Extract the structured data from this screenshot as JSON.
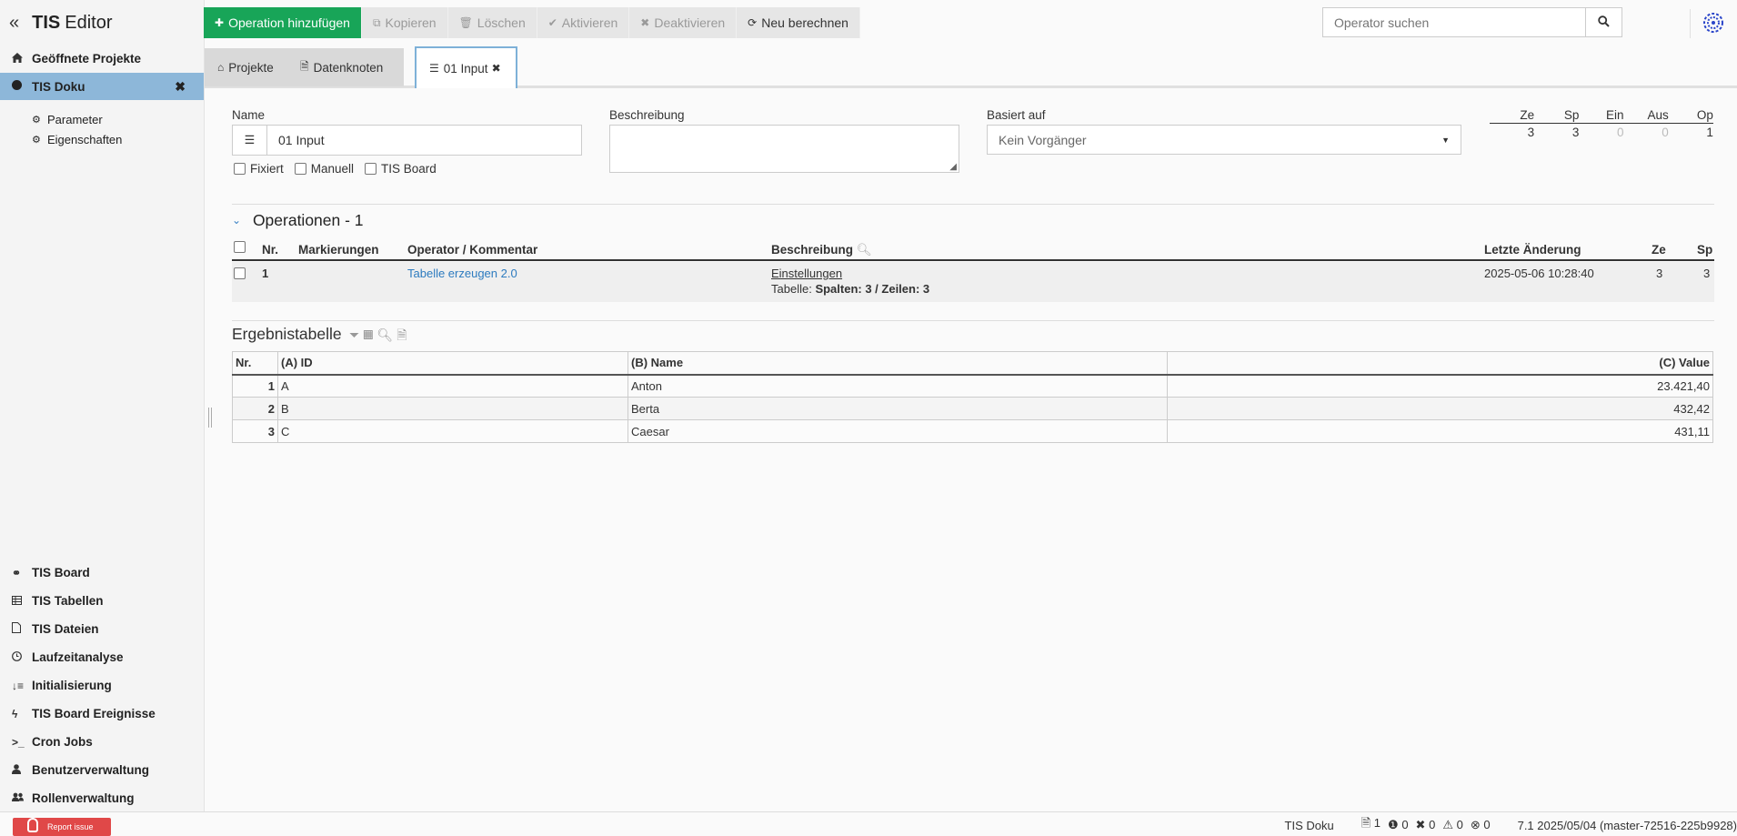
{
  "app": {
    "title_bold": "TIS",
    "title_rest": "Editor"
  },
  "sidebar": {
    "section_label": "Geöffnete Projekte",
    "project": {
      "label": "TIS Doku"
    },
    "sub_items": [
      {
        "label": "Parameter",
        "icon": "gear-icon"
      },
      {
        "label": "Eigenschaften",
        "icon": "gears-icon"
      }
    ],
    "bottom_items": [
      {
        "label": "TIS Board",
        "icon": "link-icon"
      },
      {
        "label": "TIS Tabellen",
        "icon": "table-icon"
      },
      {
        "label": "TIS Dateien",
        "icon": "file-icon"
      },
      {
        "label": "Laufzeitanalyse",
        "icon": "clock-icon"
      },
      {
        "label": "Initialisierung",
        "icon": "sort-numeric-icon"
      },
      {
        "label": "TIS Board Ereignisse",
        "icon": "bolt-icon"
      },
      {
        "label": "Cron Jobs",
        "icon": "terminal-icon"
      },
      {
        "label": "Benutzerverwaltung",
        "icon": "user-icon"
      },
      {
        "label": "Rollenverwaltung",
        "icon": "users-icon"
      }
    ]
  },
  "toolbar": {
    "add": "Operation hinzufügen",
    "copy": "Kopieren",
    "delete": "Löschen",
    "activate": "Aktivieren",
    "deactivate": "Deaktivieren",
    "recalc": "Neu berechnen"
  },
  "search": {
    "placeholder": "Operator suchen"
  },
  "tabs": [
    {
      "label": "Projekte"
    },
    {
      "label": "Datenknoten"
    },
    {
      "label": "01 Input"
    }
  ],
  "form": {
    "name_label": "Name",
    "name_value": "01 Input",
    "desc_label": "Beschreibung",
    "desc_value": "",
    "based_label": "Basiert auf",
    "based_value": "Kein Vorgänger",
    "checks": [
      "Fixiert",
      "Manuell",
      "TIS Board"
    ]
  },
  "stats": {
    "headers": [
      "Ze",
      "Sp",
      "Ein",
      "Aus",
      "Op"
    ],
    "values": [
      "3",
      "3",
      "0",
      "0",
      "1"
    ]
  },
  "operations": {
    "title": "Operationen - 1",
    "headers": {
      "nr": "Nr.",
      "marks": "Markierungen",
      "operator": "Operator / Kommentar",
      "desc": "Beschreibung",
      "changed": "Letzte Änderung",
      "ze": "Ze",
      "sp": "Sp"
    },
    "rows": [
      {
        "nr": "1",
        "operator": "Tabelle erzeugen 2.0",
        "desc_link": "Einstellungen",
        "desc_prefix": "Tabelle:",
        "desc_bold": "Spalten: 3 / Zeilen: 3",
        "changed": "2025-05-06 10:28:40",
        "ze": "3",
        "sp": "3"
      }
    ]
  },
  "result": {
    "title": "Ergebnistabelle",
    "headers": [
      "Nr.",
      "(A) ID",
      "(B) Name",
      "(C) Value"
    ],
    "rows": [
      [
        "1",
        "A",
        "Anton",
        "23.421,40"
      ],
      [
        "2",
        "B",
        "Berta",
        "432,42"
      ],
      [
        "3",
        "C",
        "Caesar",
        "431,11"
      ]
    ]
  },
  "footer": {
    "report": "Report issue",
    "project": "TIS Doku",
    "counts": {
      "files": "1",
      "info": "0",
      "errors": "0",
      "warnings": "0",
      "failed": "0"
    },
    "version": "7.1 2025/05/04 (master-72516-225b9928)"
  }
}
